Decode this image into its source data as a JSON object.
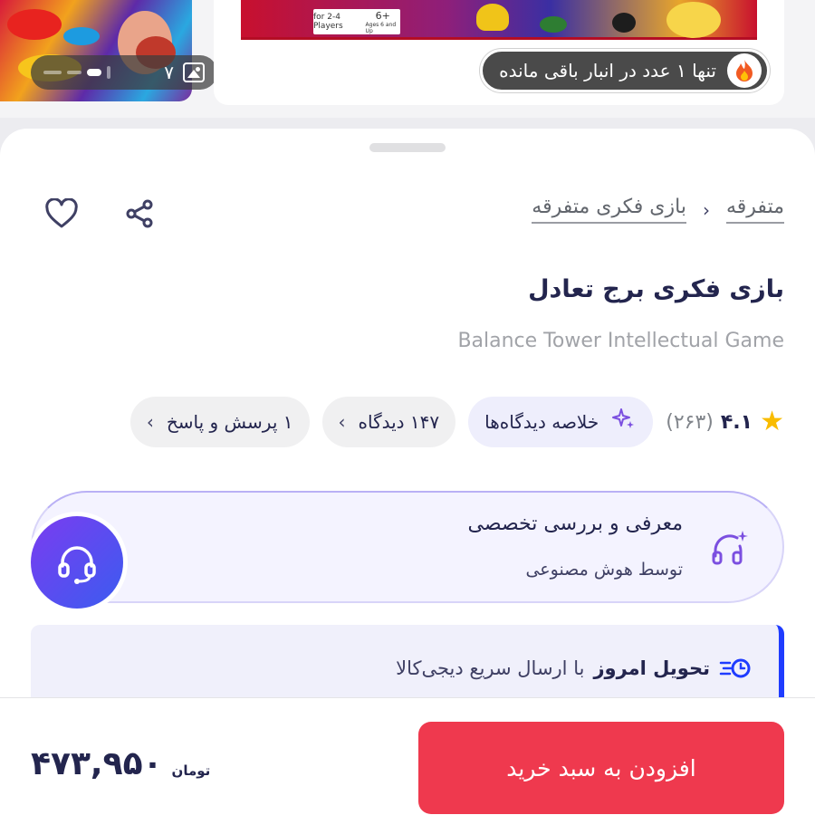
{
  "gallery": {
    "image_count": "۷",
    "stock_notice": "تنها ۱ عدد در انبار باقی مانده",
    "box_players": "for 2-4 Players",
    "box_age": "6+",
    "box_age_sub": "Ages 6 and Up"
  },
  "breadcrumb": {
    "items": [
      "متفرقه",
      "بازی فکری متفرقه"
    ]
  },
  "product": {
    "title": "بازی فکری برج تعادل",
    "subtitle": "Balance Tower Intellectual Game"
  },
  "rating": {
    "score": "۴.۱",
    "count": "(۲۶۳)"
  },
  "chips": {
    "ai_summary": "خلاصه دیدگاه‌ها",
    "reviews": "۱۴۷ دیدگاه",
    "questions": "۱ پرسش و پاسخ"
  },
  "ai_review": {
    "title": "معرفی و بررسی تخصصی",
    "subtitle": "توسط هوش مصنوعی"
  },
  "delivery": {
    "bold": "تحویل امروز",
    "rest": "با ارسال سریع دیجی‌کالا"
  },
  "purchase": {
    "button": "افزودن به سبد خرید",
    "price": "۴۷۳,۹۵۰",
    "currency": "تومان"
  },
  "colors": {
    "accent_red": "#ef394e",
    "star": "#f9bc00",
    "ai_purple": "#7b4fe0",
    "delivery_blue": "#1f3cff"
  }
}
